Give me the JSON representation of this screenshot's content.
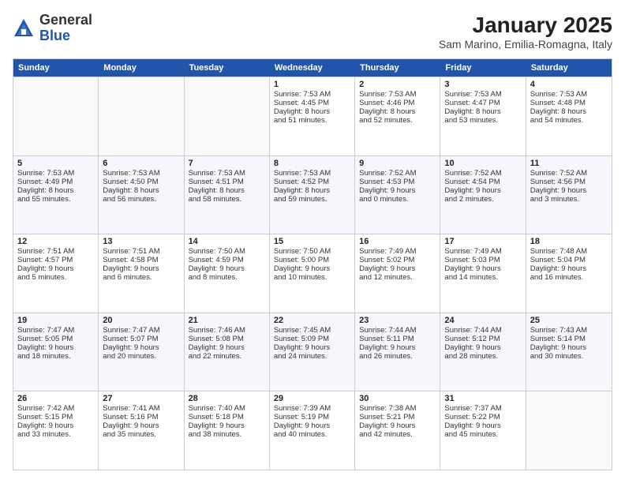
{
  "header": {
    "logo_general": "General",
    "logo_blue": "Blue",
    "title": "January 2025",
    "subtitle": "Sam Marino, Emilia-Romagna, Italy"
  },
  "calendar": {
    "days_of_week": [
      "Sunday",
      "Monday",
      "Tuesday",
      "Wednesday",
      "Thursday",
      "Friday",
      "Saturday"
    ],
    "rows": [
      [
        {
          "day": "",
          "info": ""
        },
        {
          "day": "",
          "info": ""
        },
        {
          "day": "",
          "info": ""
        },
        {
          "day": "1",
          "info": "Sunrise: 7:53 AM\nSunset: 4:45 PM\nDaylight: 8 hours\nand 51 minutes."
        },
        {
          "day": "2",
          "info": "Sunrise: 7:53 AM\nSunset: 4:46 PM\nDaylight: 8 hours\nand 52 minutes."
        },
        {
          "day": "3",
          "info": "Sunrise: 7:53 AM\nSunset: 4:47 PM\nDaylight: 8 hours\nand 53 minutes."
        },
        {
          "day": "4",
          "info": "Sunrise: 7:53 AM\nSunset: 4:48 PM\nDaylight: 8 hours\nand 54 minutes."
        }
      ],
      [
        {
          "day": "5",
          "info": "Sunrise: 7:53 AM\nSunset: 4:49 PM\nDaylight: 8 hours\nand 55 minutes."
        },
        {
          "day": "6",
          "info": "Sunrise: 7:53 AM\nSunset: 4:50 PM\nDaylight: 8 hours\nand 56 minutes."
        },
        {
          "day": "7",
          "info": "Sunrise: 7:53 AM\nSunset: 4:51 PM\nDaylight: 8 hours\nand 58 minutes."
        },
        {
          "day": "8",
          "info": "Sunrise: 7:53 AM\nSunset: 4:52 PM\nDaylight: 8 hours\nand 59 minutes."
        },
        {
          "day": "9",
          "info": "Sunrise: 7:52 AM\nSunset: 4:53 PM\nDaylight: 9 hours\nand 0 minutes."
        },
        {
          "day": "10",
          "info": "Sunrise: 7:52 AM\nSunset: 4:54 PM\nDaylight: 9 hours\nand 2 minutes."
        },
        {
          "day": "11",
          "info": "Sunrise: 7:52 AM\nSunset: 4:56 PM\nDaylight: 9 hours\nand 3 minutes."
        }
      ],
      [
        {
          "day": "12",
          "info": "Sunrise: 7:51 AM\nSunset: 4:57 PM\nDaylight: 9 hours\nand 5 minutes."
        },
        {
          "day": "13",
          "info": "Sunrise: 7:51 AM\nSunset: 4:58 PM\nDaylight: 9 hours\nand 6 minutes."
        },
        {
          "day": "14",
          "info": "Sunrise: 7:50 AM\nSunset: 4:59 PM\nDaylight: 9 hours\nand 8 minutes."
        },
        {
          "day": "15",
          "info": "Sunrise: 7:50 AM\nSunset: 5:00 PM\nDaylight: 9 hours\nand 10 minutes."
        },
        {
          "day": "16",
          "info": "Sunrise: 7:49 AM\nSunset: 5:02 PM\nDaylight: 9 hours\nand 12 minutes."
        },
        {
          "day": "17",
          "info": "Sunrise: 7:49 AM\nSunset: 5:03 PM\nDaylight: 9 hours\nand 14 minutes."
        },
        {
          "day": "18",
          "info": "Sunrise: 7:48 AM\nSunset: 5:04 PM\nDaylight: 9 hours\nand 16 minutes."
        }
      ],
      [
        {
          "day": "19",
          "info": "Sunrise: 7:47 AM\nSunset: 5:05 PM\nDaylight: 9 hours\nand 18 minutes."
        },
        {
          "day": "20",
          "info": "Sunrise: 7:47 AM\nSunset: 5:07 PM\nDaylight: 9 hours\nand 20 minutes."
        },
        {
          "day": "21",
          "info": "Sunrise: 7:46 AM\nSunset: 5:08 PM\nDaylight: 9 hours\nand 22 minutes."
        },
        {
          "day": "22",
          "info": "Sunrise: 7:45 AM\nSunset: 5:09 PM\nDaylight: 9 hours\nand 24 minutes."
        },
        {
          "day": "23",
          "info": "Sunrise: 7:44 AM\nSunset: 5:11 PM\nDaylight: 9 hours\nand 26 minutes."
        },
        {
          "day": "24",
          "info": "Sunrise: 7:44 AM\nSunset: 5:12 PM\nDaylight: 9 hours\nand 28 minutes."
        },
        {
          "day": "25",
          "info": "Sunrise: 7:43 AM\nSunset: 5:14 PM\nDaylight: 9 hours\nand 30 minutes."
        }
      ],
      [
        {
          "day": "26",
          "info": "Sunrise: 7:42 AM\nSunset: 5:15 PM\nDaylight: 9 hours\nand 33 minutes."
        },
        {
          "day": "27",
          "info": "Sunrise: 7:41 AM\nSunset: 5:16 PM\nDaylight: 9 hours\nand 35 minutes."
        },
        {
          "day": "28",
          "info": "Sunrise: 7:40 AM\nSunset: 5:18 PM\nDaylight: 9 hours\nand 38 minutes."
        },
        {
          "day": "29",
          "info": "Sunrise: 7:39 AM\nSunset: 5:19 PM\nDaylight: 9 hours\nand 40 minutes."
        },
        {
          "day": "30",
          "info": "Sunrise: 7:38 AM\nSunset: 5:21 PM\nDaylight: 9 hours\nand 42 minutes."
        },
        {
          "day": "31",
          "info": "Sunrise: 7:37 AM\nSunset: 5:22 PM\nDaylight: 9 hours\nand 45 minutes."
        },
        {
          "day": "",
          "info": ""
        }
      ]
    ]
  }
}
